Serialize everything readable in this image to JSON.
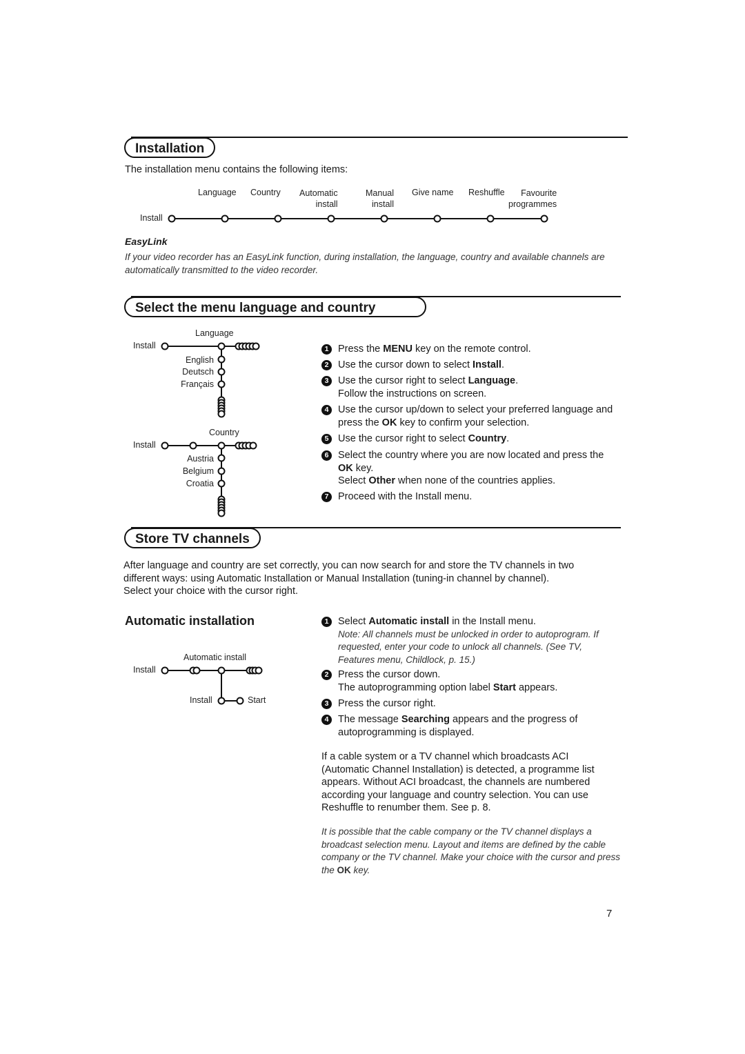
{
  "page_number": "7",
  "installation": {
    "title": "Installation",
    "intro": "The installation menu contains the following items:",
    "menu_root": "Install",
    "menu_items": [
      {
        "line1": "Language",
        "line2": ""
      },
      {
        "line1": "Country",
        "line2": ""
      },
      {
        "line1": "Automatic",
        "line2": "install"
      },
      {
        "line1": "Manual",
        "line2": "install"
      },
      {
        "line1": "Give name",
        "line2": ""
      },
      {
        "line1": "Reshuffle",
        "line2": ""
      },
      {
        "line1": "Favourite",
        "line2": "programmes"
      }
    ],
    "easylink": {
      "heading": "EasyLink",
      "text": "If your video recorder has an EasyLink function, during installation, the language, country and available channels are automatically transmitted to the video recorder."
    }
  },
  "menu_language": {
    "title": "Select the menu language and country",
    "language_diagram": {
      "root": "Install",
      "node_label": "Language",
      "options": [
        "English",
        "Deutsch",
        "Français"
      ]
    },
    "country_diagram": {
      "root": "Install",
      "node_label": "Country",
      "options": [
        "Austria",
        "Belgium",
        "Croatia"
      ]
    },
    "steps": [
      {
        "num": "1",
        "pre": "Press the ",
        "bold": "MENU",
        "post": " key on the remote control."
      },
      {
        "num": "2",
        "pre": "Use the cursor down to select ",
        "bold": "Install",
        "post": "."
      },
      {
        "num": "3",
        "pre": "Use the cursor right to select ",
        "bold": "Language",
        "post": ".",
        "extra": "Follow the instructions on screen."
      },
      {
        "num": "4",
        "pre": "Use the cursor up/down to select your preferred language and press the ",
        "bold": "OK",
        "post": " key to confirm your selection."
      },
      {
        "num": "5",
        "pre": "Use the cursor right to select ",
        "bold": "Country",
        "post": "."
      },
      {
        "num": "6",
        "pre": "Select the country where you are now located and press the ",
        "bold": "OK",
        "post": " key.",
        "extra_pre": "Select ",
        "extra_bold": "Other",
        "extra_post": " when none of the countries applies."
      },
      {
        "num": "7",
        "pre": "Proceed with the Install menu.",
        "bold": "",
        "post": ""
      }
    ]
  },
  "store_channels": {
    "title": "Store TV channels",
    "intro_lines": [
      "After language and country are set correctly, you can now search for and store the TV channels in two",
      "different ways: using Automatic Installation or Manual Installation (tuning-in channel by channel).",
      "Select your choice with the cursor right."
    ]
  },
  "automatic_installation": {
    "heading": "Automatic installation",
    "diagram": {
      "root": "Install",
      "node_label": "Automatic install",
      "sub_root": "Install",
      "sub_option": "Start"
    },
    "steps": [
      {
        "num": "1",
        "pre": "Select ",
        "bold": "Automatic install",
        "post": " in the Install menu.",
        "note": "Note: All channels must be unlocked in order to autoprogram. If requested, enter your code to unlock all channels. (See TV, Features menu, Childlock, p. 15.)"
      },
      {
        "num": "2",
        "pre": "Press the cursor down.",
        "bold": "",
        "post": "",
        "extra_pre": "The autoprogramming option label ",
        "extra_bold": "Start",
        "extra_post": " appears."
      },
      {
        "num": "3",
        "pre": "Press the cursor right.",
        "bold": "",
        "post": ""
      },
      {
        "num": "4",
        "pre": "The message ",
        "bold": "Searching",
        "post": " appears and the progress of autoprogramming is displayed."
      }
    ],
    "aci_paragraph": "If a cable system or a TV channel which broadcasts ACI (Automatic Channel Installation) is detected, a programme list appears. Without ACI broadcast, the channels are numbered according your language and country selection. You can use Reshuffle to renumber them. See p. 8.",
    "cable_note_pre": "It is possible that the cable company or the TV channel displays a broadcast selection menu. Layout and items are defined by the cable company or the TV channel. Make your choice with the cursor and press the ",
    "cable_note_bold": "OK",
    "cable_note_post": " key."
  }
}
